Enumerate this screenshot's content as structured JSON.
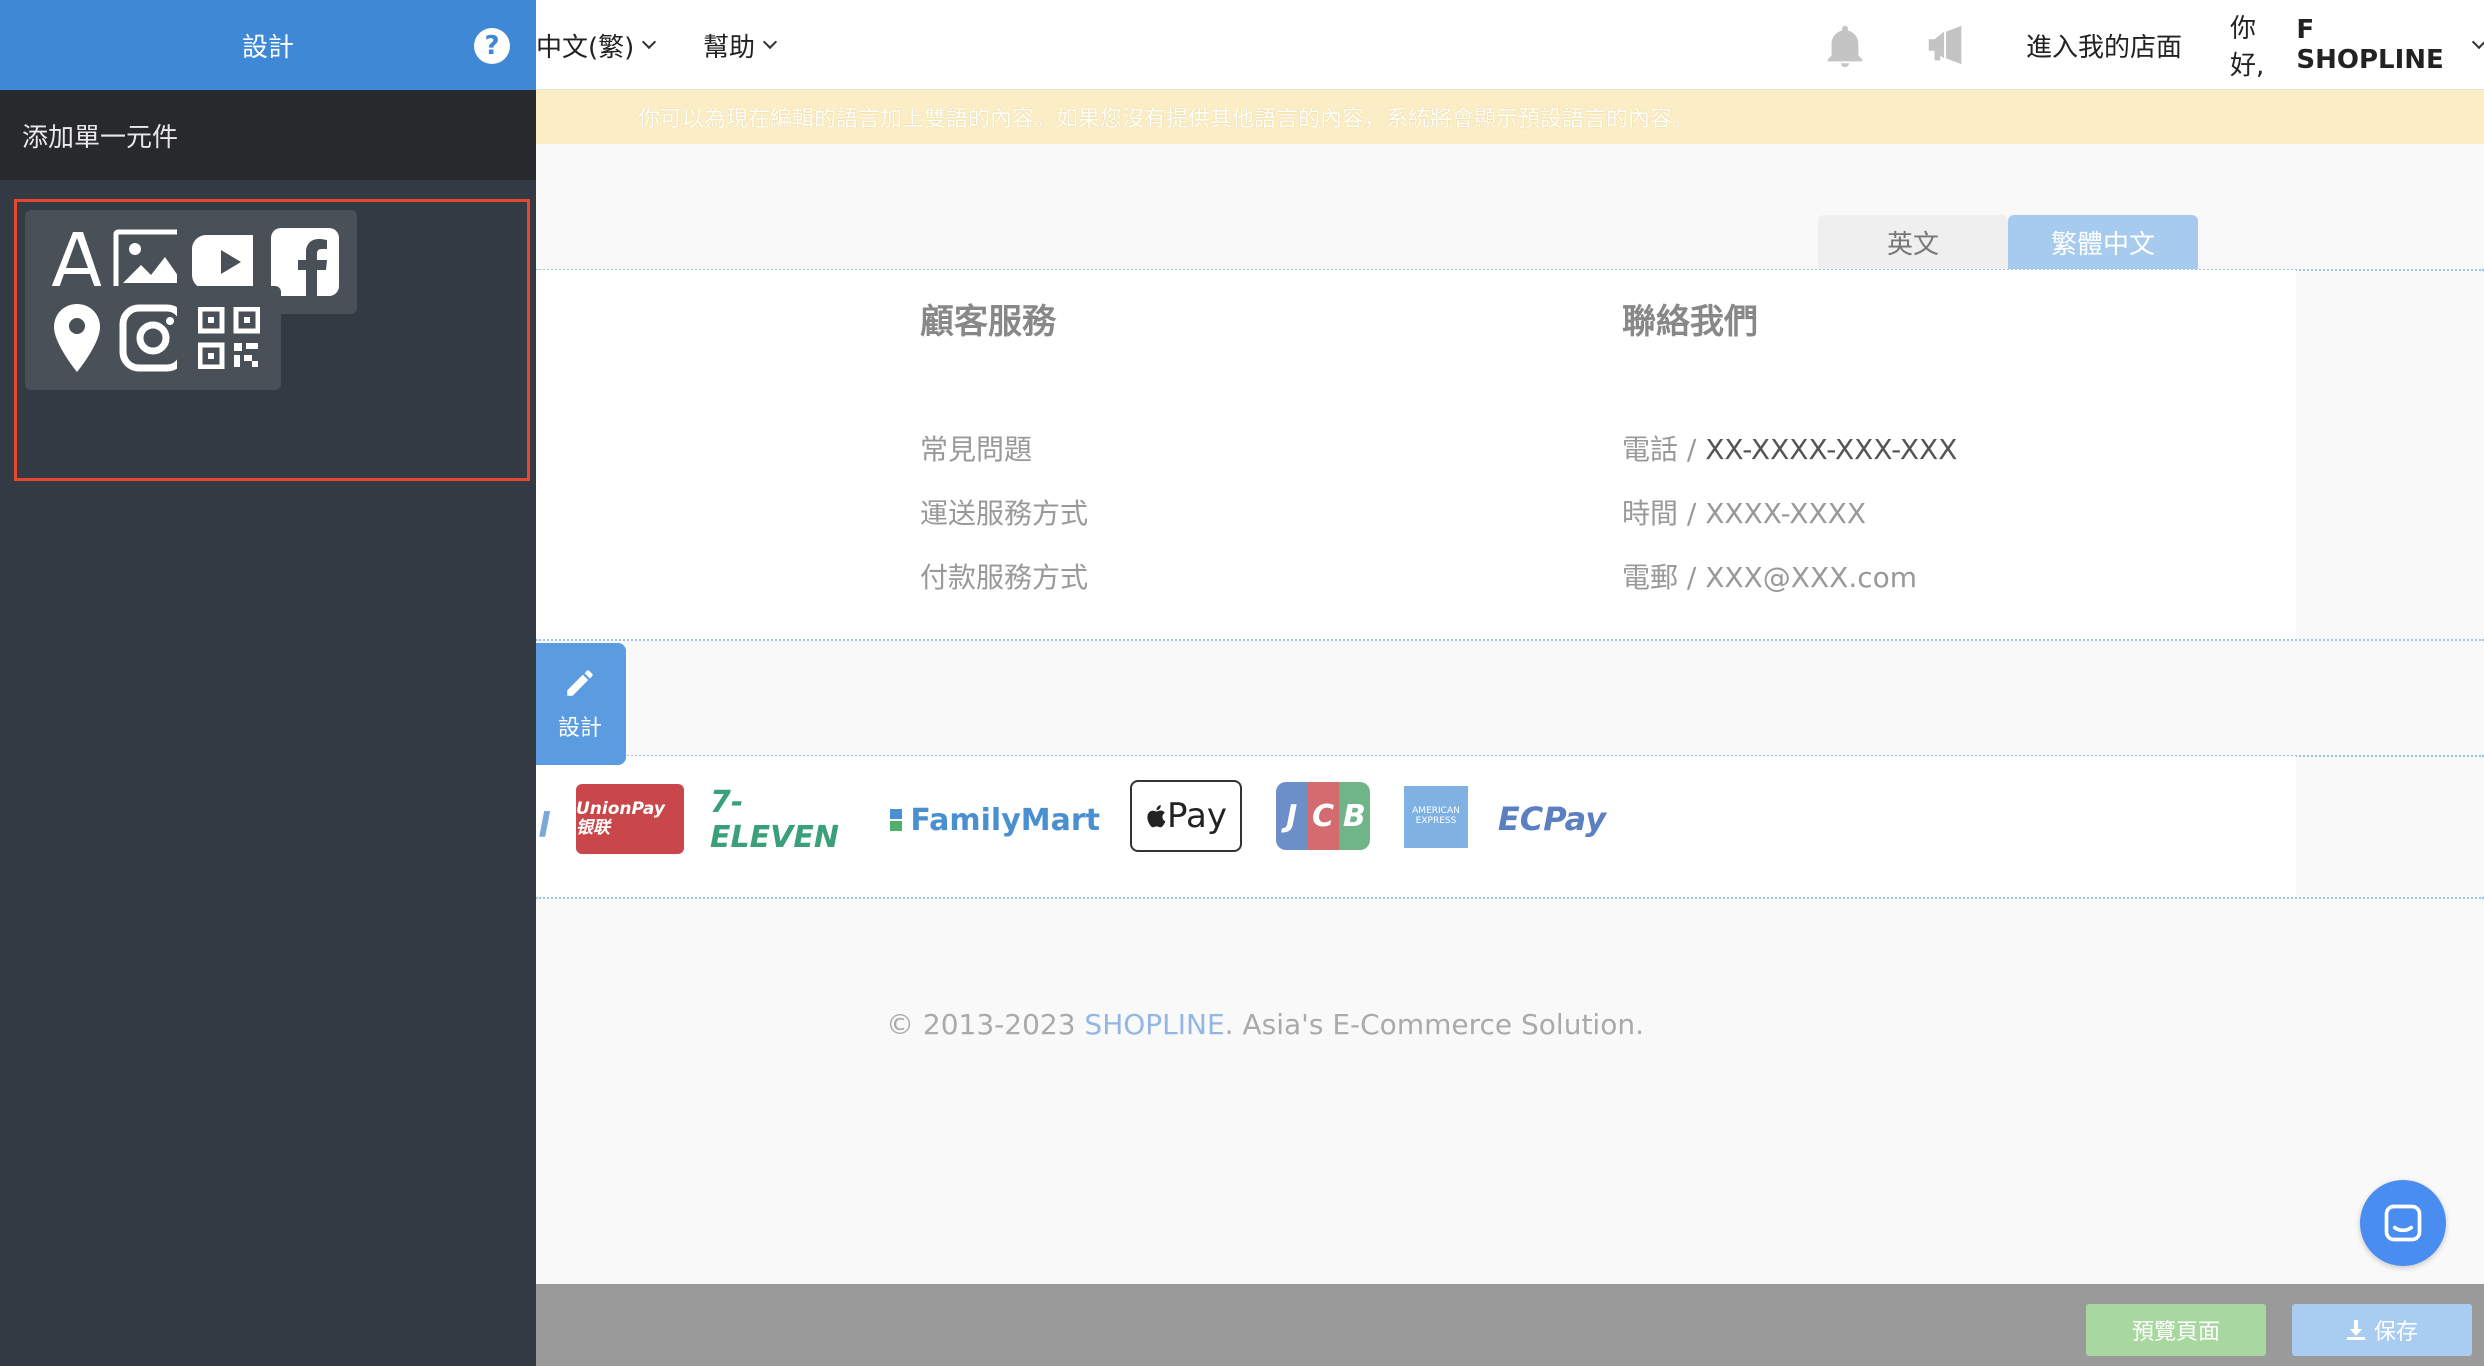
{
  "topbar": {
    "language": "中文(繁)",
    "help": "幫助",
    "enter_store": "進入我的店面",
    "greeting": "你好,",
    "username": "F SHOPLINE"
  },
  "notice": {
    "text": "你可以為現在編輯的語言加上雙語的內容。如果您沒有提供其他語言的內容，系統將會顯示預設語言的內容。"
  },
  "lang_tabs": [
    {
      "label": "英文"
    },
    {
      "label": "繁體中文"
    }
  ],
  "footer": {
    "customer_service": {
      "title": "顧客服務",
      "links": [
        "常見問題",
        "運送服務方式",
        "付款服務方式"
      ]
    },
    "contact": {
      "title": "聯絡我們",
      "items": [
        {
          "label": "電話 / ",
          "value": "XX-XXXX-XXX-XXX"
        },
        {
          "label": "時間 / ",
          "value": "XXXX-XXXX"
        },
        {
          "label": "電郵 / ",
          "value": "XXX@XXX.com"
        }
      ]
    }
  },
  "payments": [
    "UnionPay 银联",
    "7-ELEVEN",
    "FamilyMart",
    "Pay",
    "JCB",
    "AMERICAN EXPRESS",
    "ECPay"
  ],
  "copyright": {
    "prefix": "© 2013-2023 ",
    "brand": "SHOPLINE",
    "suffix": ". Asia's E-Commerce Solution."
  },
  "design_float": {
    "label": "設計"
  },
  "bottombar": {
    "preview": "預覽頁面",
    "save": "保存"
  },
  "panel": {
    "title": "設計",
    "help": "?",
    "subtitle": "添加單一元件",
    "widgets": [
      "text-widget",
      "image-widget",
      "youtube-widget",
      "facebook-widget",
      "map-widget",
      "instagram-widget",
      "qrcode-widget"
    ]
  },
  "colors": {
    "panel_header": "#3f88d6",
    "panel_bg": "#333a44",
    "highlight_border": "#e4462f",
    "notice_bg": "#fbeec6"
  }
}
